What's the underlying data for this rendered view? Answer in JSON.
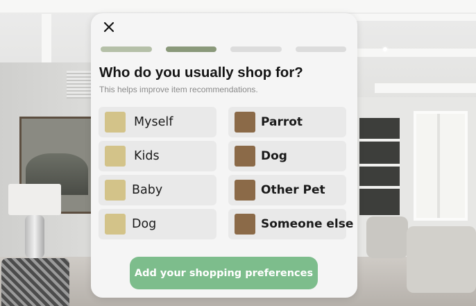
{
  "colors": {
    "progress_done": "#b5c0a8",
    "progress_current": "#8a997a",
    "progress_todo": "#dcdcdc",
    "people_swatch": "#d3c389",
    "pet_swatch": "#8b6a48",
    "cta_background": "#7dbd8c"
  },
  "modal": {
    "close_icon": "close-icon",
    "progress": {
      "total_steps": 4,
      "current_step": 2
    },
    "title": "Who do you usually shop for?",
    "subtitle": "This helps improve item recommendations.",
    "options_left": [
      {
        "label": "Myself"
      },
      {
        "label": "Kids"
      },
      {
        "label": "Baby"
      },
      {
        "label": "Dog"
      }
    ],
    "options_right": [
      {
        "label": "Parrot"
      },
      {
        "label": "Dog"
      },
      {
        "label": "Other Pet"
      },
      {
        "label": "Someone else"
      }
    ],
    "cta_label": "Add your shopping preferences"
  }
}
